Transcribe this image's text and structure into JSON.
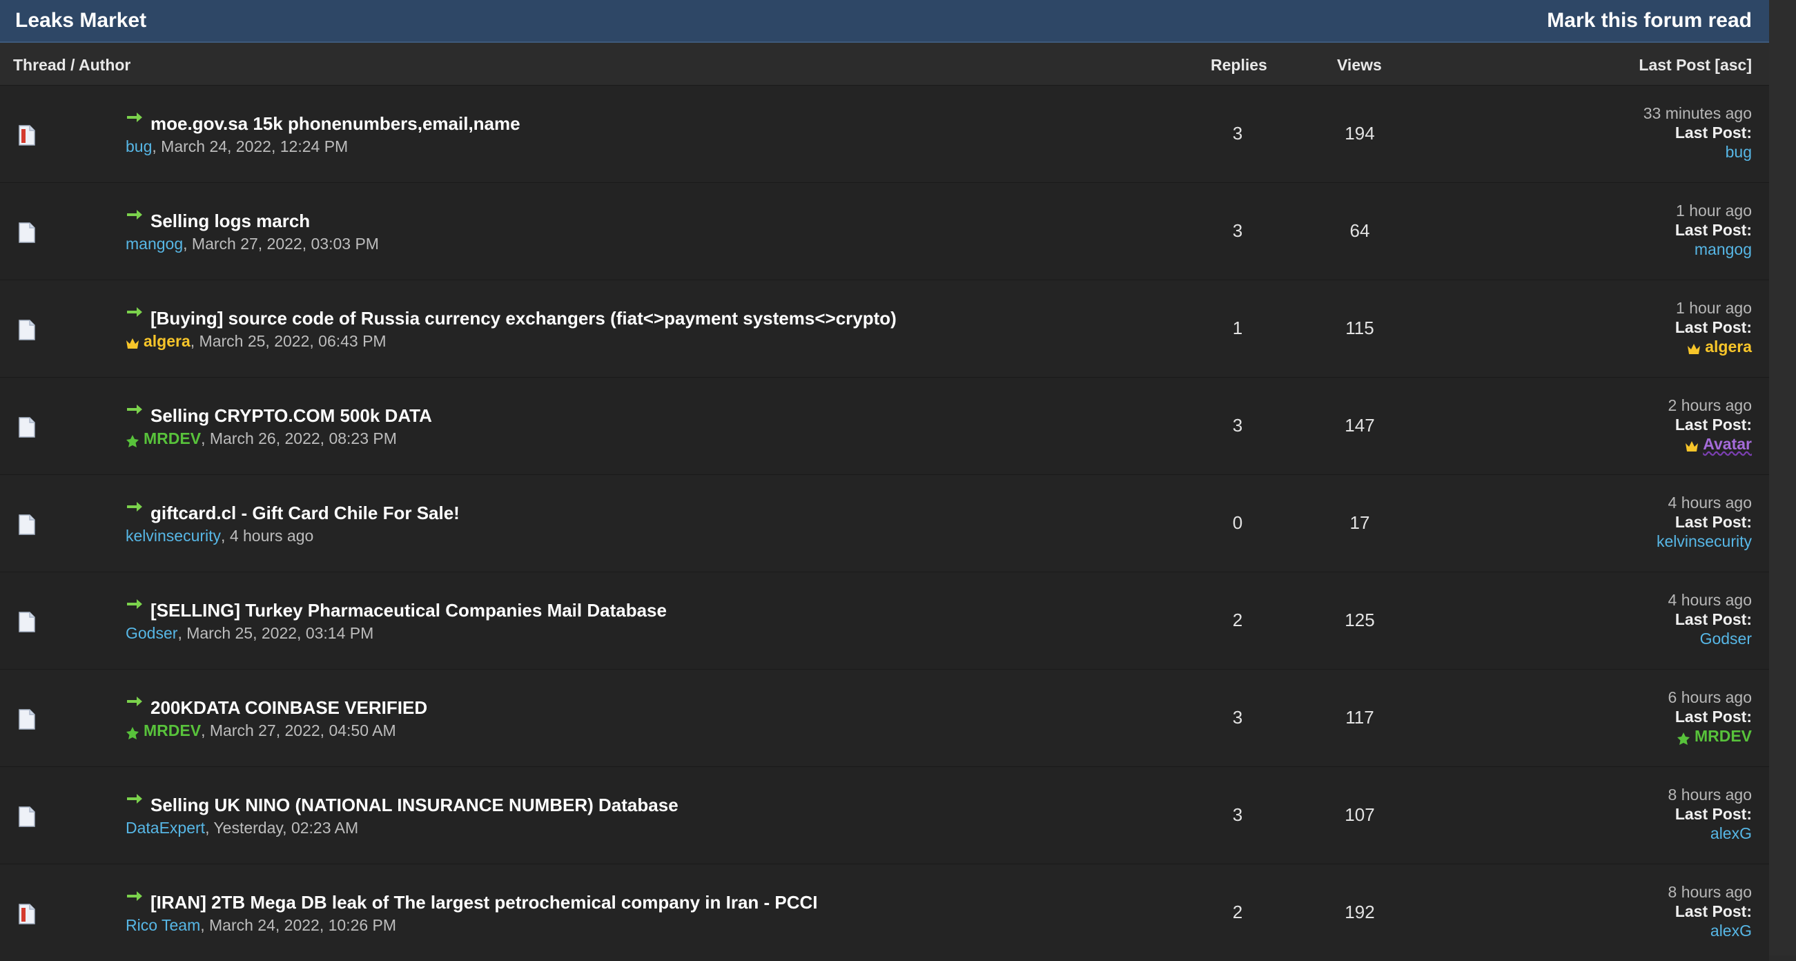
{
  "forum": {
    "title": "Leaks Market",
    "mark_read": "Mark this forum read"
  },
  "columns": {
    "thread": "Thread / Author",
    "replies": "Replies",
    "views": "Views",
    "last_post": "Last Post [asc]"
  },
  "labels": {
    "last_post": "Last Post:"
  },
  "colors": {
    "header_bg": "#2e4766",
    "username_default": "#57b7e6",
    "username_gold": "#f7c52a",
    "username_green": "#58c23b",
    "arrow_green": "#7bd24c"
  },
  "threads": [
    {
      "icon": "hot-doc-icon",
      "subject": "moe.gov.sa 15k phonenumbers,email,name",
      "author": "bug",
      "author_style": "default",
      "date": ", March 24, 2022, 12:24 PM",
      "replies": "3",
      "views": "194",
      "last_time": "33 minutes ago",
      "last_user": "bug",
      "last_style": "default"
    },
    {
      "icon": "doc-icon",
      "subject": "Selling logs march",
      "author": "mangog",
      "author_style": "default",
      "date": ", March 27, 2022, 03:03 PM",
      "replies": "3",
      "views": "64",
      "last_time": "1 hour ago",
      "last_user": "mangog",
      "last_style": "default"
    },
    {
      "icon": "doc-icon",
      "subject": "[Buying] source code of Russia currency exchangers (fiat<>payment systems<>crypto)",
      "author": "algera",
      "author_style": "gold",
      "date": ", March 25, 2022, 06:43 PM",
      "replies": "1",
      "views": "115",
      "last_time": "1 hour ago",
      "last_user": "algera",
      "last_style": "gold"
    },
    {
      "icon": "doc-icon",
      "subject": "Selling CRYPTO.COM 500k DATA",
      "author": "MRDEV",
      "author_style": "green",
      "date": ", March 26, 2022, 08:23 PM",
      "replies": "3",
      "views": "147",
      "last_time": "2 hours ago",
      "last_user": "Avatar",
      "last_style": "purple"
    },
    {
      "icon": "doc-icon",
      "subject": "giftcard.cl - Gift Card Chile For Sale!",
      "author": "kelvinsecurity",
      "author_style": "default",
      "date": ", 4 hours ago",
      "replies": "0",
      "views": "17",
      "last_time": "4 hours ago",
      "last_user": "kelvinsecurity",
      "last_style": "default"
    },
    {
      "icon": "doc-icon",
      "subject": "[SELLING] Turkey Pharmaceutical Companies Mail Database",
      "author": "Godser",
      "author_style": "default",
      "date": ", March 25, 2022, 03:14 PM",
      "replies": "2",
      "views": "125",
      "last_time": "4 hours ago",
      "last_user": "Godser",
      "last_style": "default"
    },
    {
      "icon": "doc-icon",
      "subject": "200KDATA COINBASE VERIFIED",
      "author": "MRDEV",
      "author_style": "green",
      "date": ", March 27, 2022, 04:50 AM",
      "replies": "3",
      "views": "117",
      "last_time": "6 hours ago",
      "last_user": "MRDEV",
      "last_style": "green"
    },
    {
      "icon": "doc-icon",
      "subject": "Selling UK NINO (NATIONAL INSURANCE NUMBER) Database",
      "author": "DataExpert",
      "author_style": "default",
      "date": ", Yesterday, 02:23 AM",
      "replies": "3",
      "views": "107",
      "last_time": "8 hours ago",
      "last_user": "alexG",
      "last_style": "default"
    },
    {
      "icon": "hot-doc-icon",
      "subject": "[IRAN] 2TB Mega DB leak of The largest petrochemical company in Iran - PCCI",
      "author": "Rico Team",
      "author_style": "default",
      "date": ", March 24, 2022, 10:26 PM",
      "replies": "2",
      "views": "192",
      "last_time": "8 hours ago",
      "last_user": "alexG",
      "last_style": "default"
    }
  ]
}
